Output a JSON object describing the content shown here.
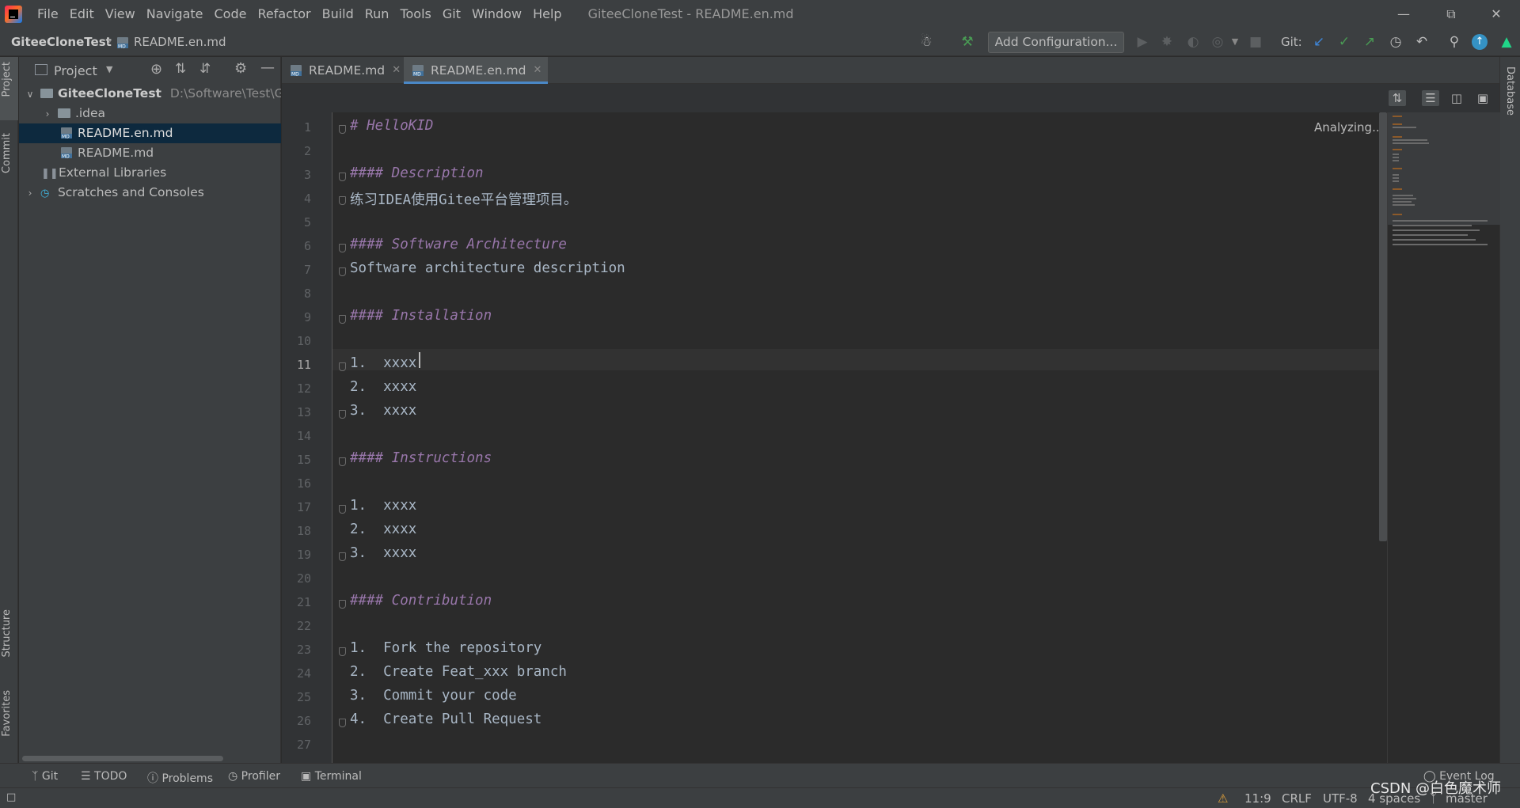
{
  "menu": {
    "items": [
      "File",
      "Edit",
      "View",
      "Navigate",
      "Code",
      "Refactor",
      "Build",
      "Run",
      "Tools",
      "Git",
      "Window",
      "Help"
    ],
    "window_title": "GiteeCloneTest - README.en.md"
  },
  "navbar": {
    "project": "GiteeCloneTest",
    "file": "README.en.md",
    "add_configuration": "Add Configuration...",
    "git_label": "Git:"
  },
  "left_strip": {
    "project": "Project",
    "commit": "Commit",
    "structure": "Structure",
    "favorites": "Favorites"
  },
  "right_strip": {
    "database": "Database"
  },
  "project_panel": {
    "title": "Project",
    "root": {
      "name": "GiteeCloneTest",
      "path": "D:\\Software\\Test\\Gite"
    },
    "items": [
      ".idea",
      "README.en.md",
      "README.md",
      "External Libraries",
      "Scratches and Consoles"
    ]
  },
  "tabs": [
    {
      "label": "README.md",
      "active": false
    },
    {
      "label": "README.en.md",
      "active": true
    }
  ],
  "editor": {
    "status": "Analyzing...",
    "current_line": 11,
    "lines": [
      {
        "n": "1",
        "text": "# HelloKID",
        "heading": true
      },
      {
        "n": "2",
        "text": "",
        "heading": false
      },
      {
        "n": "3",
        "text": "#### Description",
        "heading": true
      },
      {
        "n": "4",
        "text": "练习IDEA使用Gitee平台管理项目。",
        "heading": false
      },
      {
        "n": "5",
        "text": "",
        "heading": false
      },
      {
        "n": "6",
        "text": "#### Software Architecture",
        "heading": true
      },
      {
        "n": "7",
        "text": "Software architecture description",
        "heading": false
      },
      {
        "n": "8",
        "text": "",
        "heading": false
      },
      {
        "n": "9",
        "text": "#### Installation",
        "heading": true
      },
      {
        "n": "10",
        "text": "",
        "heading": false
      },
      {
        "n": "11",
        "text": "1.  xxxx",
        "heading": false
      },
      {
        "n": "12",
        "text": "2.  xxxx",
        "heading": false
      },
      {
        "n": "13",
        "text": "3.  xxxx",
        "heading": false
      },
      {
        "n": "14",
        "text": "",
        "heading": false
      },
      {
        "n": "15",
        "text": "#### Instructions",
        "heading": true
      },
      {
        "n": "16",
        "text": "",
        "heading": false
      },
      {
        "n": "17",
        "text": "1.  xxxx",
        "heading": false
      },
      {
        "n": "18",
        "text": "2.  xxxx",
        "heading": false
      },
      {
        "n": "19",
        "text": "3.  xxxx",
        "heading": false
      },
      {
        "n": "20",
        "text": "",
        "heading": false
      },
      {
        "n": "21",
        "text": "#### Contribution",
        "heading": true
      },
      {
        "n": "22",
        "text": "",
        "heading": false
      },
      {
        "n": "23",
        "text": "1.  Fork the repository",
        "heading": false
      },
      {
        "n": "24",
        "text": "2.  Create Feat_xxx branch",
        "heading": false
      },
      {
        "n": "25",
        "text": "3.  Commit your code",
        "heading": false
      },
      {
        "n": "26",
        "text": "4.  Create Pull Request",
        "heading": false
      },
      {
        "n": "27",
        "text": "",
        "heading": false
      }
    ]
  },
  "bottom_tools": [
    "Git",
    "TODO",
    "Problems",
    "Profiler",
    "Terminal",
    "Event Log"
  ],
  "status": {
    "position": "11:9",
    "line_sep": "CRLF",
    "encoding": "UTF-8",
    "indent": "4 spaces",
    "branch": "master",
    "watermark": "CSDN @白色魔术师"
  },
  "colors": {
    "accent": "#4a88c7",
    "heading": "#9876aa",
    "text": "#a9b7c6",
    "selection": "#0d293e"
  }
}
